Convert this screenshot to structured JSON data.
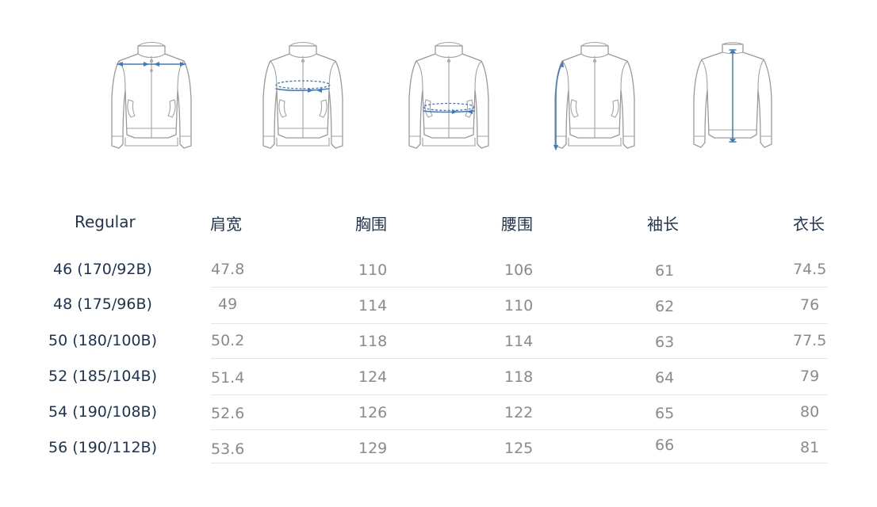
{
  "header": {
    "size_label": "Regular",
    "columns": [
      "肩宽",
      "胸围",
      "腰围",
      "袖长",
      "衣长"
    ]
  },
  "rows": [
    {
      "size": "46 (170/92B)",
      "values": [
        "47.8",
        "110",
        "106",
        "61",
        "74.5"
      ]
    },
    {
      "size": "48 (175/96B)",
      "values": [
        "49",
        "114",
        "110",
        "62",
        "76"
      ]
    },
    {
      "size": "50 (180/100B)",
      "values": [
        "50.2",
        "118",
        "114",
        "63",
        "77.5"
      ]
    },
    {
      "size": "52 (185/104B)",
      "values": [
        "51.4",
        "124",
        "118",
        "64",
        "79"
      ]
    },
    {
      "size": "54 (190/108B)",
      "values": [
        "52.6",
        "126",
        "122",
        "65",
        "80"
      ]
    },
    {
      "size": "56 (190/112B)",
      "values": [
        "53.6",
        "129",
        "125",
        "66",
        "81"
      ]
    }
  ],
  "colors": {
    "measure_accent": "#3d7ac4",
    "outline": "#9a9a9a",
    "label": "#1c3354",
    "value": "#8a8a8a"
  },
  "illustrations": [
    "shoulder-measure-icon",
    "chest-measure-icon",
    "waist-measure-icon",
    "sleeve-measure-icon",
    "length-measure-icon"
  ]
}
